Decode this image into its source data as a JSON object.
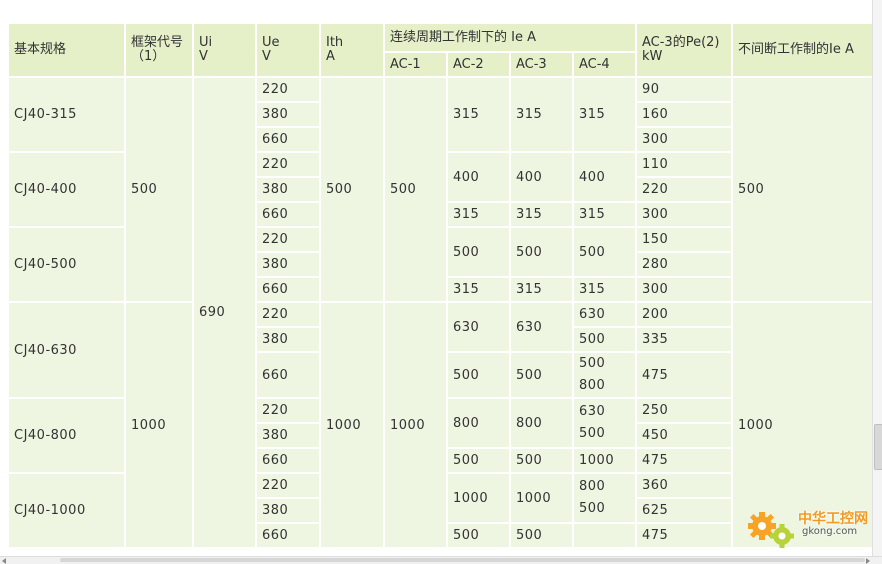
{
  "table": {
    "headers": {
      "basic_spec": "基本规格",
      "frame_code": [
        "框架代号",
        "（1）"
      ],
      "ui": [
        "Ui",
        "V"
      ],
      "ue": [
        "Ue",
        "V"
      ],
      "ith": [
        "Ith",
        "A"
      ],
      "continuous_group": "连续周期工作制下的 Ie  A",
      "ac1": "AC-1",
      "ac2": "AC-2",
      "ac3": "AC-3",
      "ac4": "AC-4",
      "ac3_pe": [
        "AC-3的Pe(2)",
        "kW"
      ],
      "uninterrupted": "不间断工作制的Ie   A"
    },
    "models": [
      "CJ40-315",
      "CJ40-400",
      "CJ40-500",
      "CJ40-630",
      "CJ40-800",
      "CJ40-1000"
    ],
    "frame_codes": [
      "500",
      "1000"
    ],
    "ui_value": "690",
    "ith_values": [
      "500",
      "1000"
    ],
    "ac1_values": [
      "500",
      "1000"
    ],
    "uninterrupted_values": [
      "500",
      "1000"
    ],
    "ue_values": [
      "220",
      "380",
      "660",
      "220",
      "380",
      "660",
      "220",
      "380",
      "660",
      "220",
      "380",
      "660",
      "220",
      "380",
      "660",
      "220",
      "380",
      "660"
    ],
    "ac2_cells": [
      "315",
      "400",
      "315",
      "500",
      "315",
      "630",
      "500",
      "800",
      "500",
      "1000",
      "500"
    ],
    "ac3_cells": [
      "315",
      "400",
      "315",
      "500",
      "315",
      "630",
      "500",
      "800",
      "500",
      "1000",
      "500"
    ],
    "ac4_cells": [
      "315",
      "400",
      "315",
      "500",
      "315",
      "630",
      "500",
      "500",
      "800",
      "630",
      "500",
      "1000",
      "800",
      "500"
    ],
    "pe_values": [
      "90",
      "160",
      "300",
      "110",
      "220",
      "300",
      "150",
      "280",
      "300",
      "200",
      "335",
      "475",
      "250",
      "450",
      "475",
      "360",
      "625",
      "475"
    ]
  },
  "watermark": {
    "name": "中华工控网",
    "url": "gkong.com"
  }
}
